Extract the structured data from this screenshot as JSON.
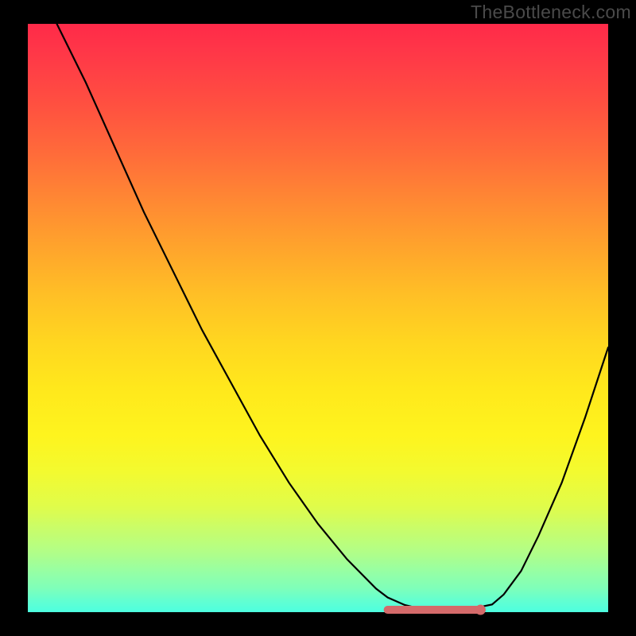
{
  "watermark": "TheBottleneck.com",
  "chart_data": {
    "type": "line",
    "title": "",
    "xlabel": "",
    "ylabel": "",
    "x": [
      0.0,
      0.05,
      0.1,
      0.15,
      0.2,
      0.25,
      0.3,
      0.35,
      0.4,
      0.45,
      0.5,
      0.55,
      0.6,
      0.62,
      0.65,
      0.68,
      0.7,
      0.73,
      0.76,
      0.8,
      0.82,
      0.85,
      0.88,
      0.92,
      0.96,
      1.0
    ],
    "y": [
      1.1,
      1.0,
      0.9,
      0.79,
      0.68,
      0.58,
      0.48,
      0.39,
      0.3,
      0.22,
      0.15,
      0.09,
      0.04,
      0.025,
      0.012,
      0.005,
      0.003,
      0.003,
      0.005,
      0.013,
      0.03,
      0.07,
      0.13,
      0.22,
      0.33,
      0.45
    ],
    "xlim": [
      0,
      1
    ],
    "ylim": [
      0,
      1
    ],
    "marker_segment": {
      "x_start": 0.62,
      "x_end": 0.78,
      "y": 0.004
    },
    "marker_dot": {
      "x": 0.78,
      "y": 0.004
    },
    "gradient_note": "background encodes vertical position: red at top through yellow to green at bottom"
  }
}
